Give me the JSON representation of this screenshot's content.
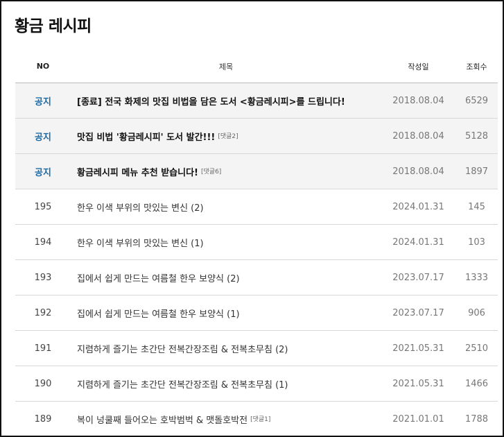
{
  "page": {
    "title": "황금 레시피"
  },
  "table": {
    "headers": {
      "no": "NO",
      "title": "제목",
      "date": "작성일",
      "views": "조회수"
    },
    "notices": [
      {
        "no": "공지",
        "title": "[종료] 전국 화제의 맛집 비법을 담은 도서 <황금레시피>를 드립니다!",
        "reply": "",
        "date": "2018.08.04",
        "views": "6529"
      },
      {
        "no": "공지",
        "title": "맛집 비법 '황금레시피' 도서 발간!!!",
        "reply": "[댓글2]",
        "date": "2018.08.04",
        "views": "5128"
      },
      {
        "no": "공지",
        "title": "황금레시피 메뉴 추천 받습니다!",
        "reply": "[댓글6]",
        "date": "2018.08.04",
        "views": "1897"
      }
    ],
    "posts": [
      {
        "no": "195",
        "title": "한우 이색 부위의 맛있는 변신 (2)",
        "reply": "",
        "date": "2024.01.31",
        "views": "145"
      },
      {
        "no": "194",
        "title": "한우 이색 부위의 맛있는 변신 (1)",
        "reply": "",
        "date": "2024.01.31",
        "views": "103"
      },
      {
        "no": "193",
        "title": "집에서 쉽게 만드는 여름철 한우 보양식 (2)",
        "reply": "",
        "date": "2023.07.17",
        "views": "1333"
      },
      {
        "no": "192",
        "title": "집에서 쉽게 만드는 여름철 한우 보양식 (1)",
        "reply": "",
        "date": "2023.07.17",
        "views": "906"
      },
      {
        "no": "191",
        "title": "지렴하게 즐기는 초간단 전복간장조림 & 전복초무침 (2)",
        "reply": "",
        "date": "2021.05.31",
        "views": "2510"
      },
      {
        "no": "190",
        "title": "지렴하게 즐기는 초간단 전복간장조림 & 전복초무침 (1)",
        "reply": "",
        "date": "2021.05.31",
        "views": "1466"
      },
      {
        "no": "189",
        "title": "복이 넝쿨째 들어오는 호박범벅 & 맷돌호박전",
        "reply": "[댓글1]",
        "date": "2021.01.01",
        "views": "1788"
      }
    ]
  }
}
